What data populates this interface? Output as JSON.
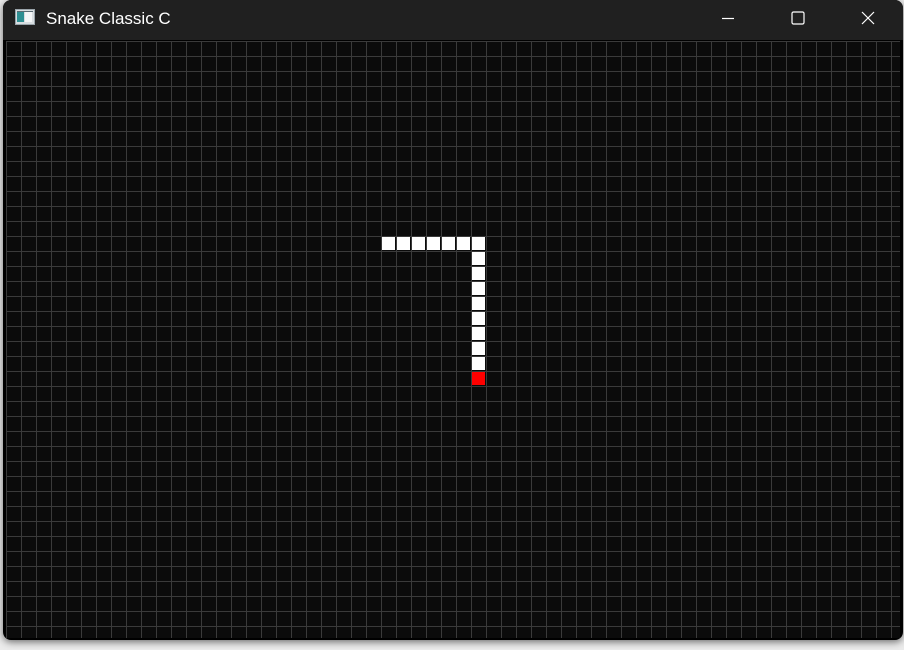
{
  "window": {
    "title": "Snake Classic C",
    "icon": "app-window-icon",
    "controls": {
      "minimize_icon": "minimize-icon",
      "maximize_icon": "maximize-icon",
      "close_icon": "close-icon"
    }
  },
  "colors": {
    "board_background": "#0b0b0b",
    "grid_line": "#3a3a3a",
    "snake_body": "#ffffff",
    "snake_head": "#ff0000",
    "titlebar": "#202020"
  },
  "game": {
    "grid_columns": 60,
    "grid_rows": 40,
    "snake": {
      "head": [
        31,
        22
      ],
      "body": [
        [
          31,
          21
        ],
        [
          31,
          20
        ],
        [
          31,
          19
        ],
        [
          31,
          18
        ],
        [
          31,
          17
        ],
        [
          31,
          16
        ],
        [
          31,
          15
        ],
        [
          31,
          14
        ],
        [
          31,
          13
        ],
        [
          30,
          13
        ],
        [
          29,
          13
        ],
        [
          28,
          13
        ],
        [
          27,
          13
        ],
        [
          26,
          13
        ],
        [
          25,
          13
        ]
      ]
    }
  }
}
